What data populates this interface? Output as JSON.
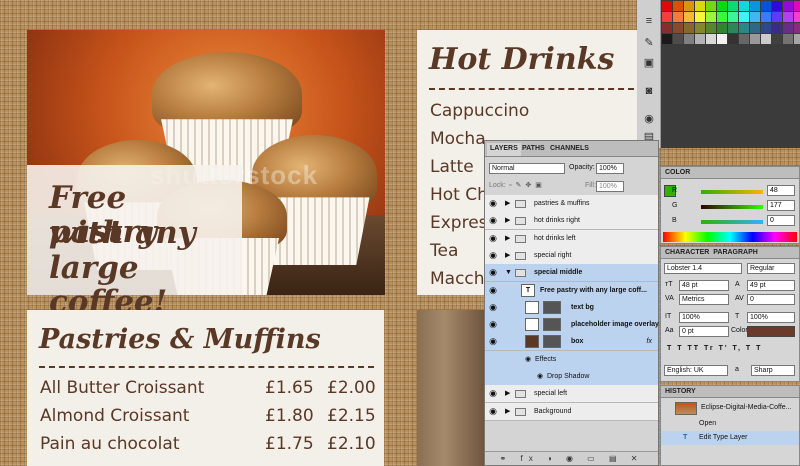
{
  "promo": {
    "line1": "Free pastry",
    "line2": "with any",
    "line3": "large coffee!",
    "watermark": "shutterstock"
  },
  "drinks": {
    "title": "Hot Drinks",
    "items": [
      "Cappuccino",
      "Mocha",
      "Latte",
      "Hot Ch",
      "Expres",
      "Tea",
      "Macch"
    ]
  },
  "pastries": {
    "title": "Pastries & Muffins",
    "rows": [
      {
        "name": "All Butter Croissant",
        "p1": "£1.65",
        "p2": "£2.00"
      },
      {
        "name": "Almond Croissant",
        "p1": "£1.80",
        "p2": "£2.15"
      },
      {
        "name": "Pain au chocolat",
        "p1": "£1.75",
        "p2": "£2.10"
      }
    ]
  },
  "layers_panel": {
    "tabs": [
      "LAYERS",
      "PATHS",
      "CHANNELS"
    ],
    "blend_mode": "Normal",
    "opacity_label": "Opacity:",
    "opacity": "100%",
    "lock_label": "Lock:",
    "fill_label": "Fill:",
    "fill": "100%",
    "layers": [
      {
        "name": "pastries & muffins",
        "type": "group"
      },
      {
        "name": "hot drinks right",
        "type": "group"
      },
      {
        "name": "hot drinks left",
        "type": "group"
      },
      {
        "name": "special right",
        "type": "group"
      },
      {
        "name": "special middle",
        "type": "group-open"
      },
      {
        "name": "Free pastry with any  large coff...",
        "type": "text"
      },
      {
        "name": "text bg",
        "type": "layer"
      },
      {
        "name": "placeholder image overlay",
        "type": "layer"
      },
      {
        "name": "box",
        "type": "layer"
      },
      {
        "name": "Effects",
        "type": "effects"
      },
      {
        "name": "Drop Shadow",
        "type": "effect"
      },
      {
        "name": "special left",
        "type": "group"
      },
      {
        "name": "Background",
        "type": "group"
      }
    ]
  },
  "color_panel": {
    "title": "COLOR",
    "r": "48",
    "g": "177",
    "b": "0",
    "r_label": "R",
    "g_label": "G",
    "b_label": "B"
  },
  "character_panel": {
    "tabs": [
      "CHARACTER",
      "PARAGRAPH"
    ],
    "font": "Lobster 1.4",
    "style": "Regular",
    "size": "48 pt",
    "leading": "49 pt",
    "kerning": "Metrics",
    "tracking": "0",
    "vscale": "100%",
    "hscale": "100%",
    "baseline": "0 pt",
    "color_label": "Color:",
    "language": "English: UK",
    "antialias": "Sharp",
    "aa_label": "a",
    "formatting": [
      "T",
      "T",
      "TT",
      "Tr",
      "T'",
      "T,",
      "T",
      "T"
    ]
  },
  "history_panel": {
    "title": "HISTORY",
    "items": [
      "Eclipse-Digital-Media-Coffe...",
      "Open",
      "Edit Type Layer"
    ]
  },
  "colors": {
    "brown": "#5a3826",
    "panel": "#d6d6d6",
    "selection": "#bcd3ef",
    "fg_color": "#30b100",
    "char_color": "#6b3a2a"
  }
}
